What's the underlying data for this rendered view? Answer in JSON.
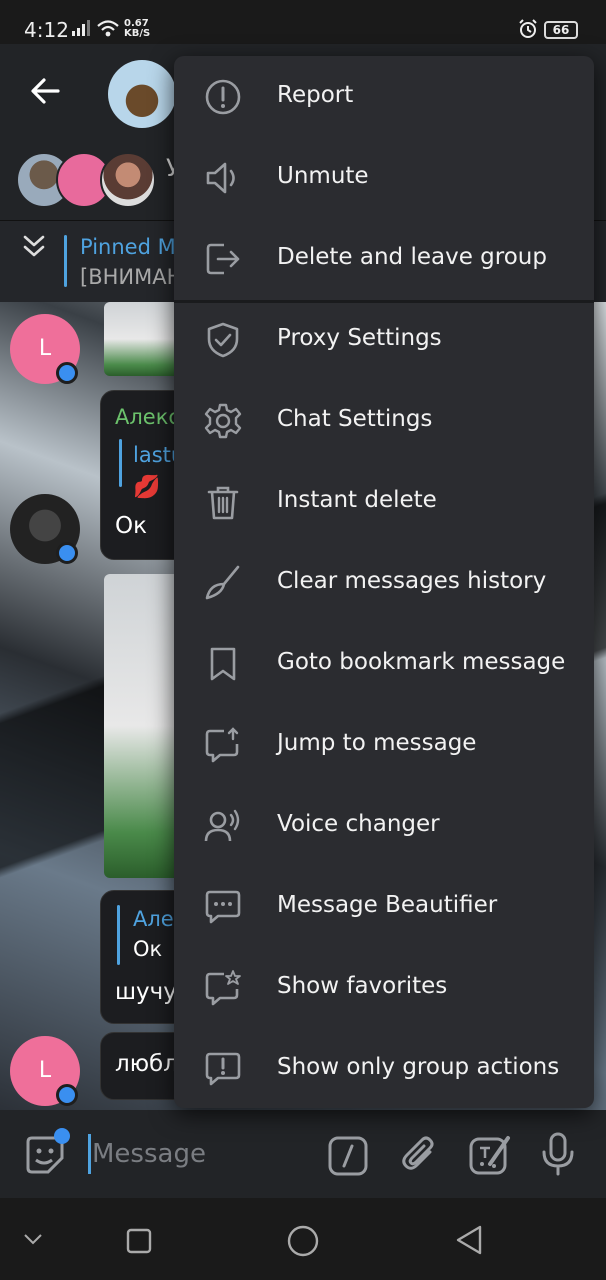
{
  "status_bar": {
    "time": "4:12",
    "net_speed_value": "0.67",
    "net_speed_unit": "KB/S",
    "battery": "66"
  },
  "chat_header": {
    "subtitle_fragment": "У"
  },
  "pinned": {
    "title": "Pinned M",
    "text": "[ВНИМАН"
  },
  "messages": [
    {
      "avatar_letter": "L"
    },
    {
      "sender_fragment": "Алекс",
      "reply_fragment": "lastu",
      "emoji": "💋",
      "text": "Ок"
    },
    {
      "reply_sender_fragment": "Але",
      "reply_text": "Ок",
      "text": "шучу"
    },
    {
      "avatar_letter": "L",
      "text": "любл"
    }
  ],
  "composer": {
    "placeholder": "Message"
  },
  "menu": {
    "items": [
      {
        "label": "Report",
        "icon": "report-icon"
      },
      {
        "label": "Unmute",
        "icon": "speaker-icon"
      },
      {
        "label": "Delete and leave group",
        "icon": "leave-icon"
      },
      {
        "label": "Proxy Settings",
        "icon": "shield-icon"
      },
      {
        "label": "Chat Settings",
        "icon": "gear-icon"
      },
      {
        "label": "Instant delete",
        "icon": "trash-icon"
      },
      {
        "label": "Clear messages history",
        "icon": "broom-icon"
      },
      {
        "label": "Goto bookmark message",
        "icon": "bookmark-icon"
      },
      {
        "label": "Jump to message",
        "icon": "jump-icon"
      },
      {
        "label": "Voice changer",
        "icon": "voice-icon"
      },
      {
        "label": "Message Beautifier",
        "icon": "chat-dots-icon"
      },
      {
        "label": "Show favorites",
        "icon": "chat-star-icon"
      },
      {
        "label": "Show only group actions",
        "icon": "chat-alert-icon"
      }
    ]
  },
  "colors": {
    "accent": "#4fa3e0",
    "menu_bg": "#2b2c30",
    "header_bg": "#222427",
    "avatar_pink": "#ef6f9a",
    "online_blue": "#3a8ff0"
  }
}
